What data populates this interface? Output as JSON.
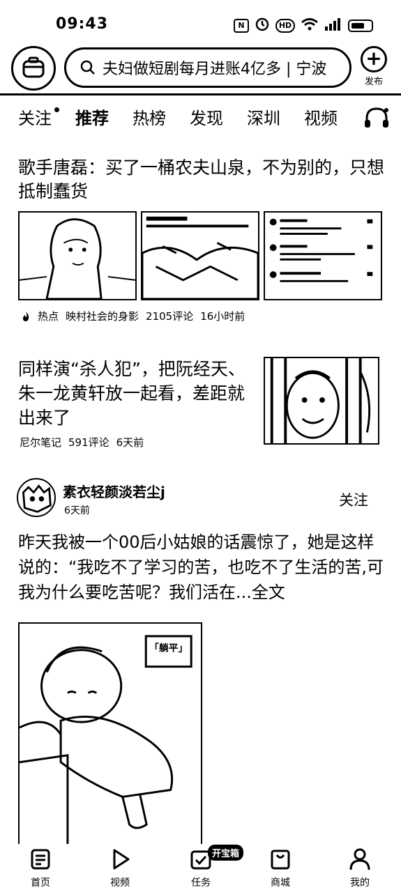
{
  "status_bar": {
    "time": "09:43",
    "icon_nfc": "N",
    "icon_hd": "HD"
  },
  "header": {
    "search_query": "夫妇做短剧每月进账4亿多 | 宁波",
    "publish_label": "发布"
  },
  "tabs": [
    {
      "label": "关注"
    },
    {
      "label": "推荐"
    },
    {
      "label": "热榜"
    },
    {
      "label": "发现"
    },
    {
      "label": "深圳"
    },
    {
      "label": "视频"
    }
  ],
  "feed": {
    "article1": {
      "title": "歌手唐磊：买了一桶农夫山泉，不为别的，只想抵制蠢货",
      "badge": "热点",
      "source": "映村社会的身影",
      "comments": "2105评论",
      "time": "16小时前"
    },
    "article2": {
      "title": "同样演“杀人犯”，把阮经天、朱一龙黄轩放一起看，差距就出来了",
      "source": "尼尔笔记",
      "comments": "591评论",
      "time": "6天前"
    },
    "post": {
      "author": "素衣轻颜淡若尘j",
      "time": "6天前",
      "follow_label": "关注",
      "text": "昨天我被一个00后小姑娘的话震惊了，她是这样说的：“我吃不了学习的苦，也吃不了生活的苦,可我为什么要吃苦呢？我们活在...全文",
      "image_caption": "「躺平」"
    }
  },
  "bottom_nav": {
    "items": [
      {
        "label": "首页",
        "icon": "home-doc-icon"
      },
      {
        "label": "视频",
        "icon": "play-icon"
      },
      {
        "label": "任务",
        "icon": "task-check-icon"
      },
      {
        "label": "商城",
        "icon": "shop-bag-icon"
      },
      {
        "label": "我的",
        "icon": "person-icon"
      }
    ],
    "treasure_badge": "开宝箱"
  }
}
